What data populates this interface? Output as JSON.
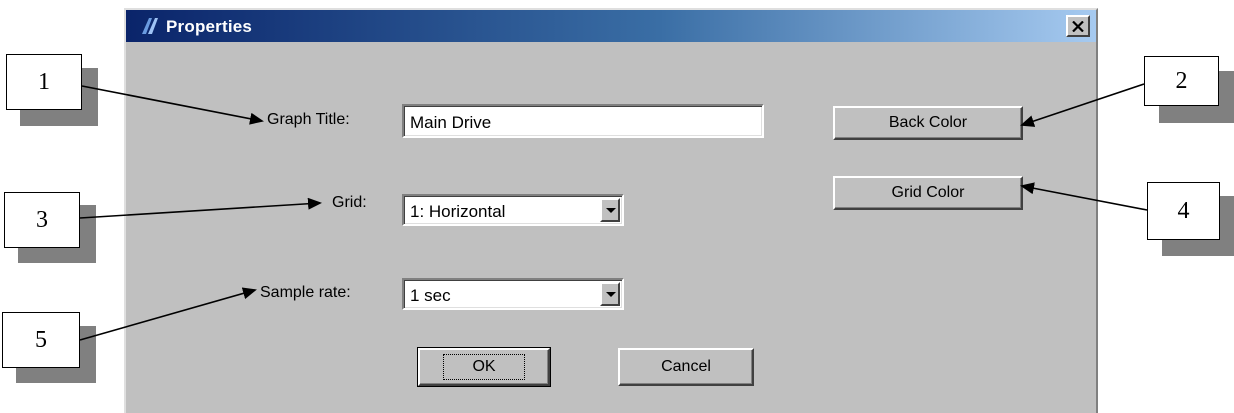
{
  "dialog": {
    "title": "Properties",
    "close_glyph": "×",
    "graph_title_label": "Graph Title:",
    "graph_title_value": "Main Drive",
    "grid_label": "Grid:",
    "grid_value": "1: Horizontal",
    "sample_rate_label": "Sample rate:",
    "sample_rate_value": "1 sec",
    "back_color_label": "Back Color",
    "grid_color_label": "Grid Color",
    "ok_label": "OK",
    "cancel_label": "Cancel"
  },
  "callouts": [
    "1",
    "2",
    "3",
    "4",
    "5"
  ],
  "icons": {
    "title_icon": "properties-icon",
    "close": "close-icon",
    "dropdown": "chevron-down-icon"
  },
  "colors": {
    "titlebar_start": "#0a246a",
    "titlebar_end": "#a6caf0",
    "dialog_face": "#c0c0c0"
  }
}
